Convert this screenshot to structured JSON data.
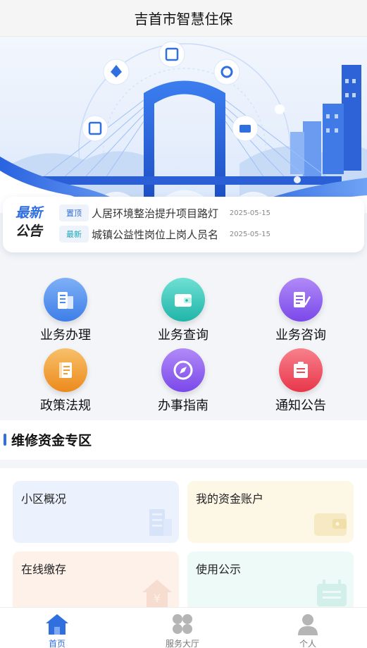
{
  "header": {
    "title": "吉首市智慧住保"
  },
  "notice": {
    "logo_line1": "最新",
    "logo_line2": "公告",
    "items": [
      {
        "tag": "置顶",
        "tag_color": "#2f6fe0",
        "text": "人居环境整治提升项目路灯",
        "date": "2025-05-15"
      },
      {
        "tag": "最新",
        "tag_color": "#19a8b8",
        "text": "城镇公益性岗位上岗人员名",
        "date": "2025-05-15"
      }
    ]
  },
  "services": [
    {
      "label": "业务办理",
      "icon": "building-icon",
      "color": "#4a8df0"
    },
    {
      "label": "业务查询",
      "icon": "wallet-icon",
      "color": "#2cc5b8"
    },
    {
      "label": "业务咨询",
      "icon": "notepad-icon",
      "color": "#8a5cf0"
    },
    {
      "label": "政策法规",
      "icon": "book-icon",
      "color": "#f0a030"
    },
    {
      "label": "办事指南",
      "icon": "compass-icon",
      "color": "#8a5cf0"
    },
    {
      "label": "通知公告",
      "icon": "notice-board-icon",
      "color": "#f04a5a"
    }
  ],
  "section": {
    "title": "维修资金专区"
  },
  "cards": [
    {
      "label": "小区概况",
      "icon": "building-icon",
      "bg": "#ecf2fd"
    },
    {
      "label": "我的资金账户",
      "icon": "wallet-icon",
      "bg": "#fdf7e6"
    },
    {
      "label": "在线缴存",
      "icon": "house-yuan-icon",
      "bg": "#fdf1ea"
    },
    {
      "label": "使用公示",
      "icon": "board-icon",
      "bg": "#eefaf8"
    }
  ],
  "tabbar": [
    {
      "label": "首页",
      "icon": "home-icon",
      "active": true
    },
    {
      "label": "服务大厅",
      "icon": "grid-icon",
      "active": false
    },
    {
      "label": "个人",
      "icon": "user-icon",
      "active": false
    }
  ]
}
